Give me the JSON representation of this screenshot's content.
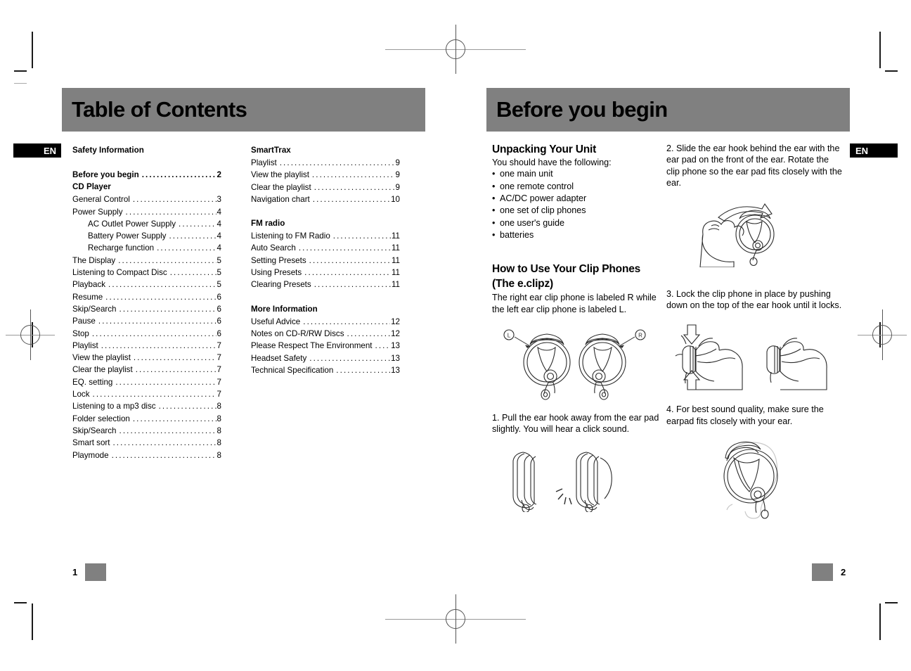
{
  "document": {
    "language_badge": "EN"
  },
  "left_page": {
    "chapter_title": "Table of Contents",
    "folio": "1",
    "toc_column_1": [
      {
        "type": "head",
        "label": "Safety Information"
      },
      {
        "type": "gap"
      },
      {
        "type": "head-entry",
        "label": "Before you begin",
        "page": "2"
      },
      {
        "type": "head",
        "label": "CD Player"
      },
      {
        "type": "entry",
        "label": "General Control",
        "page": "3"
      },
      {
        "type": "entry",
        "label": "Power Supply",
        "page": "4"
      },
      {
        "type": "sub",
        "label": "AC Outlet Power Supply",
        "page": "4"
      },
      {
        "type": "sub",
        "label": "Battery Power Supply",
        "page": "4"
      },
      {
        "type": "sub",
        "label": "Recharge function",
        "page": "4"
      },
      {
        "type": "entry",
        "label": "The Display",
        "page": "5"
      },
      {
        "type": "entry",
        "label": "Listening to Compact Disc",
        "page": "5"
      },
      {
        "type": "entry",
        "label": "Playback",
        "page": "5"
      },
      {
        "type": "entry",
        "label": "Resume",
        "page": "6"
      },
      {
        "type": "entry",
        "label": "Skip/Search",
        "page": "6"
      },
      {
        "type": "entry",
        "label": "Pause",
        "page": "6"
      },
      {
        "type": "entry",
        "label": "Stop",
        "page": "6"
      },
      {
        "type": "entry",
        "label": "Playlist",
        "page": "7"
      },
      {
        "type": "entry",
        "label": "View the playlist",
        "page": "7"
      },
      {
        "type": "entry",
        "label": "Clear the playlist",
        "page": "7"
      },
      {
        "type": "entry",
        "label": "EQ. setting",
        "page": "7"
      },
      {
        "type": "entry",
        "label": "Lock",
        "page": "7"
      },
      {
        "type": "entry",
        "label": "Listening to a mp3 disc",
        "page": "8"
      },
      {
        "type": "entry",
        "label": "Folder selection",
        "page": "8"
      },
      {
        "type": "entry",
        "label": "Skip/Search",
        "page": "8"
      },
      {
        "type": "entry",
        "label": "Smart sort",
        "page": "8"
      },
      {
        "type": "entry",
        "label": "Playmode",
        "page": "8"
      }
    ],
    "toc_column_2": [
      {
        "type": "head",
        "label": "SmartTrax"
      },
      {
        "type": "entry",
        "label": "Playlist",
        "page": "9"
      },
      {
        "type": "entry",
        "label": "View the playlist",
        "page": "9"
      },
      {
        "type": "entry",
        "label": "Clear the playlist",
        "page": "9"
      },
      {
        "type": "entry",
        "label": "Navigation chart",
        "page": "10"
      },
      {
        "type": "gap"
      },
      {
        "type": "head",
        "label": "FM radio"
      },
      {
        "type": "entry",
        "label": "Listening to FM Radio",
        "page": "11"
      },
      {
        "type": "entry",
        "label": "Auto Search",
        "page": "11"
      },
      {
        "type": "entry",
        "label": "Setting Presets",
        "page": "11"
      },
      {
        "type": "entry",
        "label": "Using Presets",
        "page": "11"
      },
      {
        "type": "entry",
        "label": "Clearing Presets",
        "page": "11"
      },
      {
        "type": "gap"
      },
      {
        "type": "head",
        "label": "More Information"
      },
      {
        "type": "entry",
        "label": "Useful Advice",
        "page": "12"
      },
      {
        "type": "entry",
        "label": "Notes on CD-R/RW Discs",
        "page": "12"
      },
      {
        "type": "entry",
        "label": "Please Respect The Environment",
        "page": "13"
      },
      {
        "type": "entry",
        "label": "Headset Safety",
        "page": "13"
      },
      {
        "type": "entry",
        "label": "Technical Specification",
        "page": "13"
      }
    ]
  },
  "right_page": {
    "chapter_title": "Before you begin",
    "folio": "2",
    "unpacking": {
      "heading": "Unpacking Your Unit",
      "intro": "You should have the following:",
      "items": [
        "one main unit",
        "one remote control",
        "AC/DC power adapter",
        "one set of clip phones",
        "one user's guide",
        "batteries"
      ]
    },
    "clip_phones": {
      "heading_line1": "How to Use Your Clip Phones",
      "heading_line2": "(The e.clipz)",
      "intro": "The right ear clip phone is labeled R while the left ear clip phone is labeled L.",
      "diagram_label_left": "L",
      "diagram_label_right": "R",
      "step1": "1.  Pull the ear hook away from the ear pad slightly. You will hear a click sound.",
      "step2": "2. Slide the ear hook behind the ear with the ear pad on the front of the ear. Rotate the clip phone so the ear pad fits closely with the ear.",
      "step3": "3.  Lock the clip phone in place by pushing down on the top of the ear hook until it locks.",
      "step4": "4. For best sound quality, make sure the earpad fits closely with your ear."
    }
  },
  "colors": {
    "chapter_bar": "#808080",
    "badge_bg": "#000000",
    "badge_text": "#ffffff",
    "folio_square": "#808080"
  }
}
